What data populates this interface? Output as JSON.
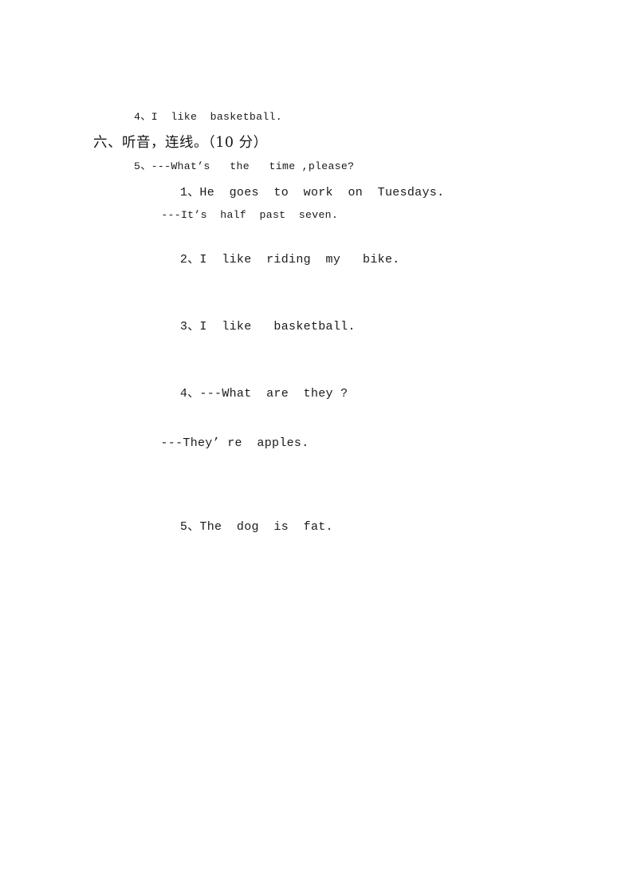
{
  "document": {
    "type": "worksheet-page",
    "background_color": "#ffffff",
    "text_color": "#1a1a1a"
  },
  "carryover": {
    "lines": [
      "4、I  like  basketball.",
      "5、---What’s   the   time ,please?",
      "---It’s  half  past  seven."
    ]
  },
  "section": {
    "heading": "六、听音，连线。（10 分）",
    "number": "六",
    "title": "听音，连线。",
    "points": "（10 分）"
  },
  "items": [
    {
      "number": "1、",
      "text": "He  goes  to  work  on  Tuesdays."
    },
    {
      "number": "2、",
      "text": "I  like  riding  my   bike."
    },
    {
      "number": "3、",
      "text": "I  like   basketball."
    },
    {
      "number": "4、",
      "text": "---What  are  they ?",
      "sub": "---They’ re  apples."
    },
    {
      "number": "5、",
      "text": "The  dog  is  fat."
    }
  ]
}
